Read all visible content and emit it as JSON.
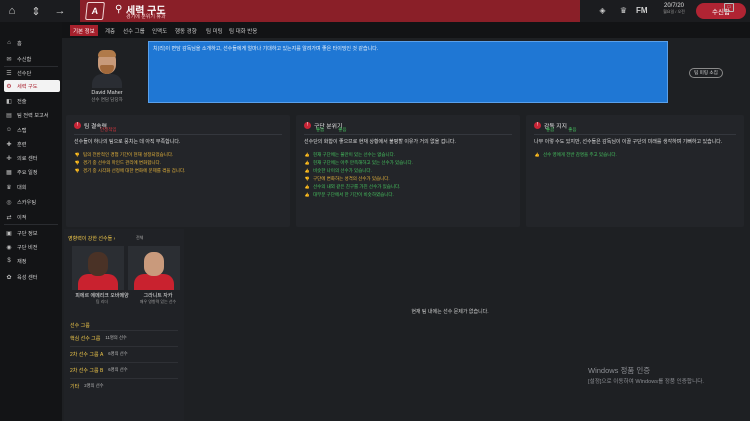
{
  "topbar": {
    "title": "세력 구도",
    "subtitle": "경기에 분위기 휴과",
    "club_initials": "A",
    "nav_icons": [
      "home-icon",
      "chevron-up-down-icon",
      "arrow-right-icon"
    ],
    "date": "20/7/20",
    "date_sub": "월요일 / 오전",
    "continue_label": "수신함",
    "right_icons": [
      "shield-icon",
      "trophy-icon",
      "fm-icon",
      "mail-icon",
      "more-icon"
    ],
    "fm_label": "FM"
  },
  "sidebar": {
    "items": [
      {
        "label": "홈",
        "icon": "home-icon"
      },
      {
        "label": "수신함",
        "icon": "inbox-icon"
      },
      {
        "label": "선수단",
        "icon": "squad-icon"
      },
      {
        "label": "세력 구도",
        "icon": "dynamics-icon",
        "active": true
      },
      {
        "label": "전술",
        "icon": "tactics-icon"
      },
      {
        "label": "팀 전력 보고서",
        "icon": "report-icon"
      },
      {
        "label": "스탭",
        "icon": "staff-icon"
      },
      {
        "label": "훈련",
        "icon": "training-icon"
      },
      {
        "label": "의료 센터",
        "icon": "medical-icon"
      },
      {
        "label": "주요 일정",
        "icon": "calendar-icon"
      },
      {
        "label": "대회",
        "icon": "trophy-icon"
      },
      {
        "label": "스카우팅",
        "icon": "scouting-icon"
      },
      {
        "label": "이적",
        "icon": "transfer-icon"
      },
      {
        "label": "구단 정보",
        "icon": "club-icon"
      },
      {
        "label": "구단 비전",
        "icon": "vision-icon"
      },
      {
        "label": "재정",
        "icon": "finance-icon"
      },
      {
        "label": "육성 센터",
        "icon": "youth-icon"
      }
    ]
  },
  "tabs": [
    "기본 정보",
    "계층",
    "선수 그룹",
    "인맥도",
    "행동 경향",
    "팀 미팅",
    "팀 대화 반응"
  ],
  "profile": {
    "name": "David Maher",
    "role": "선수 면담 담당자"
  },
  "message": "치(리)이 면담 감독님을 소개하고, 선수들에게 얼마나 기대하고 있는지를 알려가며 좋은 타이밍인 것 같습니다.",
  "meeting_button": "팀 미팅 소집",
  "cards": [
    {
      "title": "팀 결속력",
      "sub_a": "",
      "sub_b": "안정적임",
      "sub_color": "#d9363f",
      "desc": "선수들이 하나의 팀으로 뭉치는 데 아직 부족합니다.",
      "points": [
        {
          "type": "neg",
          "text": "팀의 전반적인 경험 기간이 현재 설정되었습니다."
        },
        {
          "type": "neg",
          "text": "경기 중 선수의 마인드 관리에 변화합니다."
        },
        {
          "type": "neg",
          "text": "경기 중 시각화 선정에 대한 변화에 문제를 겪을 겁니다."
        }
      ]
    },
    {
      "title": "구단 분위기",
      "sub_a": "좋음",
      "sub_b": "좋음",
      "sub_color": "#46c35f",
      "desc": "선수단의 화합이 좋으므로 현재 상황에서 불평할 이유가 거의 없을 겁니다.",
      "points": [
        {
          "type": "pos",
          "text": "현재 구단에는 불만이 있는 선수는 없습니다."
        },
        {
          "type": "pos",
          "text": "현재 구단에는 아주 만족해하고 있는 선수가 있습니다."
        },
        {
          "type": "pos",
          "text": "비슷한 나이의 선수가 있습니다."
        },
        {
          "type": "neg",
          "text": "구단에 변화하는 성격의 선수가 있습니다."
        },
        {
          "type": "pos",
          "text": "선수의 내외 같은 친구를 가진 선수가 있습니다."
        },
        {
          "type": "pos",
          "text": "대부분 구단에서 한 기간이 비슷하였습니다."
        }
      ]
    },
    {
      "title": "감독 지지",
      "sub_a": "좋음",
      "sub_b": "좋음",
      "sub_color": "#46c35f",
      "desc": "나무 이렇 수도 있지만, 선수들은 감독님이 이끌 구단의 미래를 생각하며 기뻐하고 있습니다.",
      "points": [
        {
          "type": "pos",
          "text": "선수 영에게 전반 감명을 주고 있습니다."
        }
      ]
    }
  ],
  "influencers": {
    "title": "영향력이 강한 선수들",
    "more": "전체",
    "players": [
      {
        "name": "피에르 에메리크 오바메양",
        "note": "팀 리더"
      },
      {
        "name": "그라니트 자카",
        "note": "매우 영향력 있는 선수"
      }
    ]
  },
  "groups": {
    "title": "선수 그룹",
    "items": [
      {
        "label": "핵심 선수 그룹",
        "count": "11명의 선수"
      },
      {
        "label": "2차 선수 그룹 A",
        "count": "6명의 선수"
      },
      {
        "label": "2차 선수 그룹 B",
        "count": "6명의 선수"
      },
      {
        "label": "기타",
        "count": "2명의 선수"
      }
    ]
  },
  "empty_message": "현재 팀 내에는 선수 문제가 없습니다.",
  "watermark": {
    "title": "Windows 정품 인증",
    "sub": "[설정]으로 이동하여 Windows를 정품 인증합니다."
  },
  "colors": {
    "accent_red": "#a6202c",
    "topbar_red": "#8a1f28",
    "positive": "#46c35f",
    "negative": "#e6b43b",
    "message_blue": "#1f77d4"
  }
}
